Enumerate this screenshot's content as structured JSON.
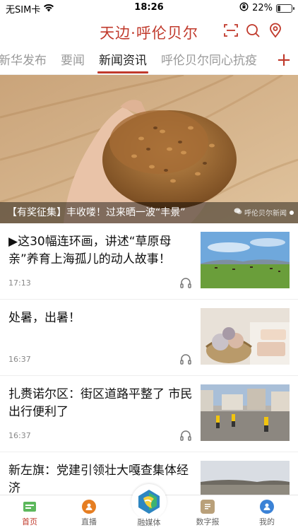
{
  "status_bar": {
    "carrier": "无SIM卡",
    "time": "18:26",
    "battery": "22%",
    "battery_level": 0.22
  },
  "header": {
    "title": "天边·呼伦贝尔",
    "icons": [
      "scan-icon",
      "search-icon",
      "location-icon"
    ]
  },
  "tabs": [
    {
      "label": "新华发布",
      "active": false
    },
    {
      "label": "要闻",
      "active": false
    },
    {
      "label": "新闻资讯",
      "active": true
    },
    {
      "label": "呼伦贝尔同心抗疫",
      "active": false
    }
  ],
  "tabs_more": "+",
  "banner": {
    "caption": "【有奖征集】丰收喽！过来晒一波“丰景”",
    "source": "呼伦贝尔新闻"
  },
  "news": [
    {
      "title": "▶这30幅连环画，讲述“草原母亲”养育上海孤儿的动人故事！",
      "time": "17:13"
    },
    {
      "title": "处暑，出暑！",
      "time": "16:37"
    },
    {
      "title": "扎赉诺尔区：街区道路平整了 市民出行便利了",
      "time": "16:37"
    },
    {
      "title": "新左旗：党建引领壮大嘎查集体经济",
      "time": ""
    }
  ],
  "tabbar": [
    {
      "label": "首页",
      "icon": "home-icon",
      "active": true,
      "color": "#5cb85c"
    },
    {
      "label": "直播",
      "icon": "live-icon",
      "active": false,
      "color": "#e67e22"
    },
    {
      "label": "融媒体",
      "icon": "media-logo-icon",
      "active": false,
      "color": "#2e86c1"
    },
    {
      "label": "数字报",
      "icon": "newspaper-icon",
      "active": false,
      "color": "#b9a07a"
    },
    {
      "label": "我的",
      "icon": "profile-icon",
      "active": false,
      "color": "#3b82d6"
    }
  ],
  "colors": {
    "accent": "#c0392b",
    "tab_inactive": "#999999"
  }
}
